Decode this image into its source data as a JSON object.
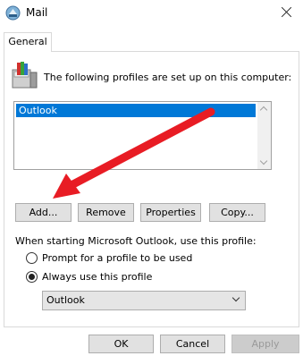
{
  "window": {
    "title": "Mail",
    "icon": "mail-icon"
  },
  "tabs": [
    {
      "label": "General"
    }
  ],
  "profiles_label": "The following profiles are set up on this computer:",
  "profiles": [
    {
      "name": "Outlook",
      "selected": true
    }
  ],
  "profile_buttons": {
    "add": "Add...",
    "remove": "Remove",
    "properties": "Properties",
    "copy": "Copy..."
  },
  "startup": {
    "label": "When starting Microsoft Outlook, use this profile:",
    "options": [
      {
        "label": "Prompt for a profile to be used",
        "checked": false
      },
      {
        "label": "Always use this profile",
        "checked": true
      }
    ],
    "selected_profile": "Outlook"
  },
  "dialog_buttons": {
    "ok": "OK",
    "cancel": "Cancel",
    "apply": "Apply"
  },
  "colors": {
    "selection": "#0078d7",
    "annotation_arrow": "#e81c24"
  }
}
